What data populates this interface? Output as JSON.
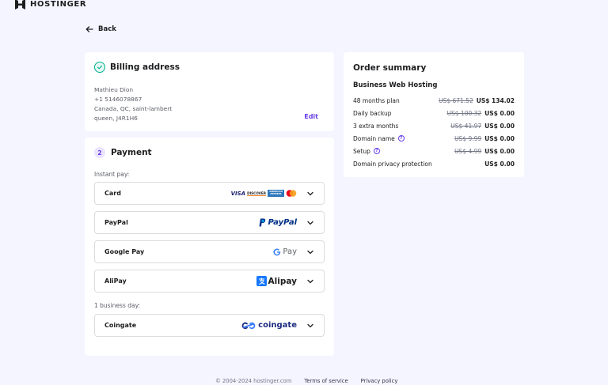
{
  "brand": {
    "name": "HOSTINGER"
  },
  "nav": {
    "back_label": "Back"
  },
  "billing": {
    "title": "Billing address",
    "lines": [
      "Mathieu Dion",
      "+1 5146078867",
      "Canada, QC, saint-lambert",
      "queen, J4R1H6"
    ],
    "edit_label": "Edit"
  },
  "payment": {
    "step": "2",
    "title": "Payment",
    "instant_label": "Instant pay:",
    "business_label": "1 business day:",
    "methods": [
      {
        "name": "Card",
        "icons": [
          "visa-logo",
          "discover-logo",
          "amex-logo",
          "mastercard-logo"
        ]
      },
      {
        "name": "PayPal",
        "logo_text": "PayPal"
      },
      {
        "name": "Google Pay",
        "logo_text": "Pay"
      },
      {
        "name": "AliPay",
        "logo_text": "Alipay"
      },
      {
        "name": "Coingate",
        "logo_text": "coingate"
      }
    ],
    "card_logo_text": {
      "visa": "VISA",
      "discover": "DISCOVER",
      "amex": "AMERICAN EXPRESS"
    }
  },
  "summary": {
    "title": "Order summary",
    "plan": "Business Web Hosting",
    "rows": [
      {
        "label": "48 months plan",
        "old": "US$ 671.52",
        "new": "US$ 134.02",
        "info": false
      },
      {
        "label": "Daily backup",
        "old": "US$ 100.32",
        "new": "US$ 0.00",
        "info": false
      },
      {
        "label": "3 extra months",
        "old": "US$ 41.97",
        "new": "US$ 0.00",
        "info": false
      },
      {
        "label": "Domain name",
        "old": "US$ 9.99",
        "new": "US$ 0.00",
        "info": true
      },
      {
        "label": "Setup",
        "old": "US$ 4.99",
        "new": "US$ 0.00",
        "info": true
      },
      {
        "label": "Domain privacy protection",
        "old": "",
        "new": "US$ 0.00",
        "info": false
      }
    ]
  },
  "footer": {
    "copyright": "© 2004-2024 hostinger.com",
    "terms": "Terms of service",
    "privacy": "Privacy policy"
  },
  "colors": {
    "accent": "#673de6",
    "success": "#00b090",
    "background": "#f4f5ff"
  }
}
